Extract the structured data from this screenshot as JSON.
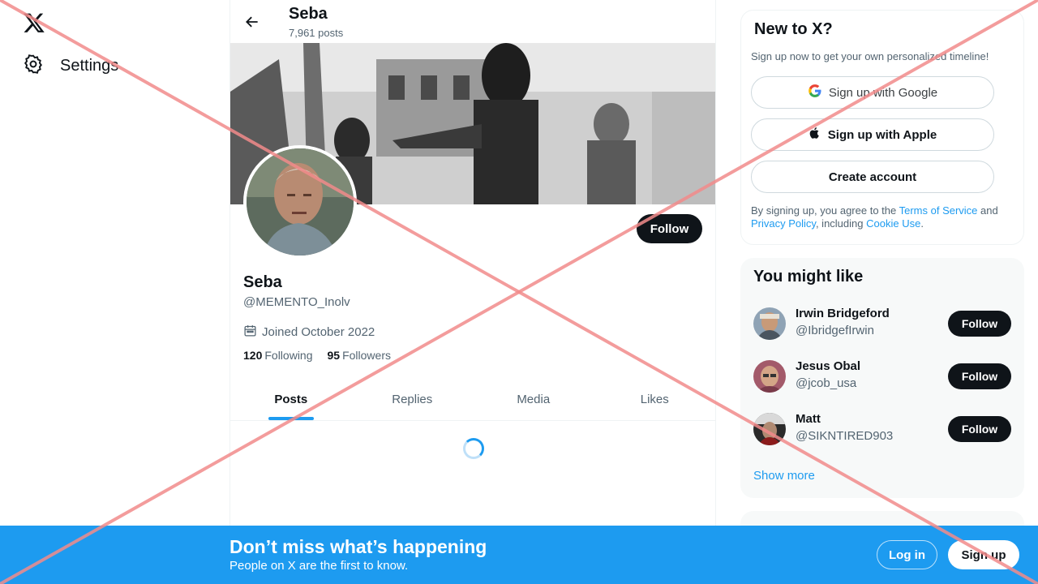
{
  "nav": {
    "logo_icon": "x-logo-icon",
    "settings_label": "Settings"
  },
  "header": {
    "name": "Seba",
    "posts_count": "7,961 posts"
  },
  "profile": {
    "name": "Seba",
    "handle": "@MEMENTO_Inolv",
    "joined": "Joined October 2022",
    "following_count": "120",
    "following_label": "Following",
    "followers_count": "95",
    "followers_label": "Followers",
    "follow_label": "Follow"
  },
  "tabs": [
    {
      "label": "Posts",
      "active": true
    },
    {
      "label": "Replies",
      "active": false
    },
    {
      "label": "Media",
      "active": false
    },
    {
      "label": "Likes",
      "active": false
    }
  ],
  "signup": {
    "title": "New to X?",
    "subtitle": "Sign up now to get your own personalized timeline!",
    "google_label": "Sign up with Google",
    "apple_label": "Sign up with Apple",
    "create_label": "Create account",
    "legal_prefix": "By signing up, you agree to the ",
    "terms_link": "Terms of Service",
    "legal_and": " and ",
    "privacy_link": "Privacy Policy",
    "legal_including": ", including ",
    "cookie_link": "Cookie Use",
    "legal_end": "."
  },
  "might_like": {
    "title": "You might like",
    "users": [
      {
        "name": "Irwin Bridgeford",
        "handle": "@IbridgefIrwin",
        "follow_label": "Follow"
      },
      {
        "name": "Jesus Obal",
        "handle": "@jcob_usa",
        "follow_label": "Follow"
      },
      {
        "name": "Matt",
        "handle": "@SIKNTIRED903",
        "follow_label": "Follow"
      }
    ],
    "show_more": "Show more"
  },
  "bottom_banner": {
    "title": "Don’t miss what’s happening",
    "subtitle": "People on X are the first to know.",
    "login_label": "Log in",
    "signup_label": "Sign up"
  },
  "colors": {
    "accent": "#1d9bf0",
    "text_primary": "#0f1419",
    "text_secondary": "#536471",
    "overlay_cross": "#f28b8b"
  }
}
